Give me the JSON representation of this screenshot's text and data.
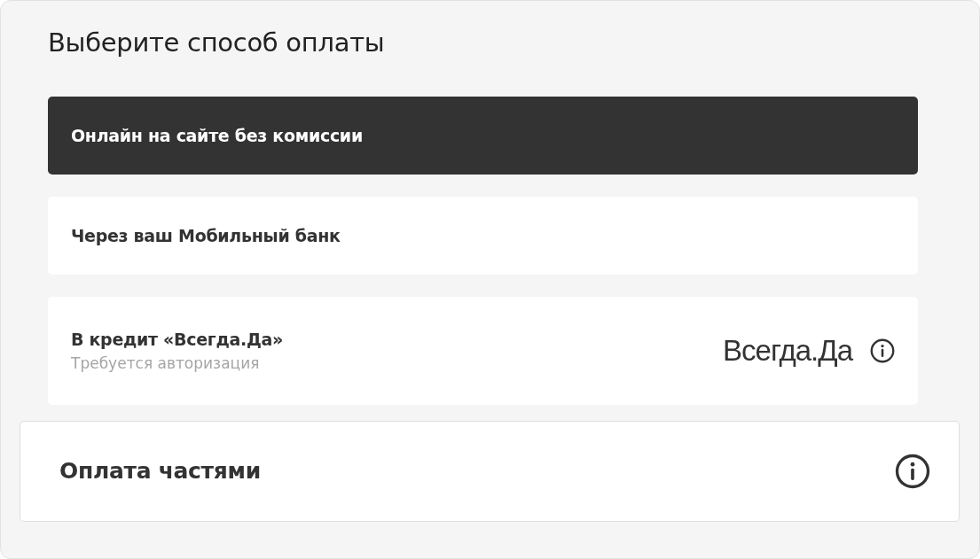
{
  "title": "Выберите способ оплаты",
  "options": [
    {
      "kind": "plain",
      "label": "Онлайн на сайте без комиссии",
      "selected": true
    },
    {
      "kind": "plain",
      "label": "Через ваш Мобильный банк",
      "selected": false
    },
    {
      "kind": "credit",
      "label": "В кредит «Всегда.Да»",
      "subtitle": "Требуется авторизация",
      "logo": "Всегда.Да",
      "selected": false
    }
  ],
  "installments": {
    "label": "Оплата частями"
  }
}
